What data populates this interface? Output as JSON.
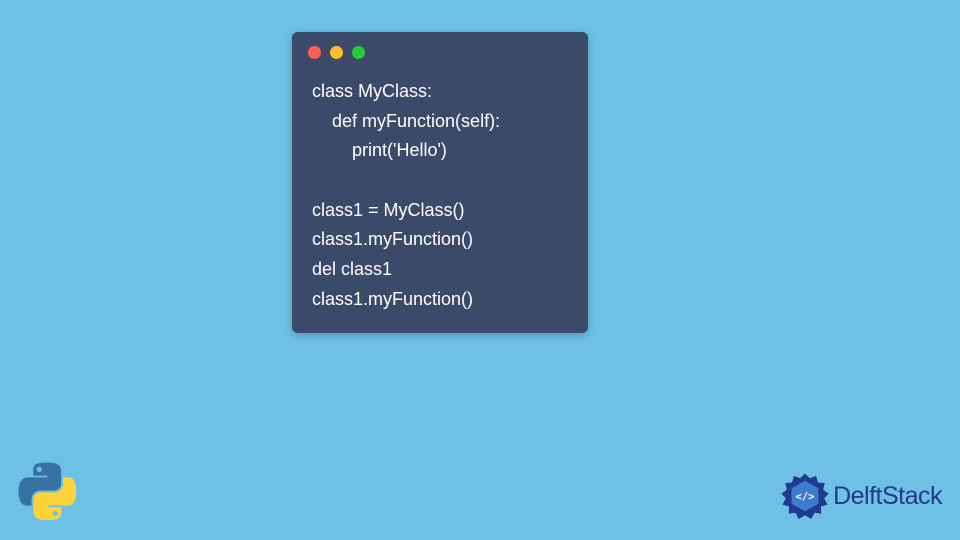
{
  "code": {
    "lines": [
      "class MyClass:",
      "    def myFunction(self):",
      "        print('Hello')",
      "",
      "class1 = MyClass()",
      "class1.myFunction()",
      "del class1",
      "class1.myFunction()"
    ]
  },
  "brand": {
    "name_part1": "Delft",
    "name_part2": "Stack"
  }
}
